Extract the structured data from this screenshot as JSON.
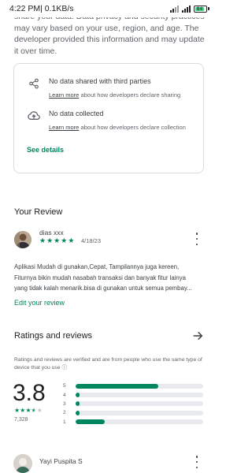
{
  "status_bar": {
    "time": "4:22 PM",
    "speed": " | 0.1KB/s",
    "battery_level": "84"
  },
  "data_safety": {
    "intro_text": "share your data. Data privacy and security practices may vary based on your use, region, and age. The developer provided this information and may update it over time.",
    "items": [
      {
        "icon": "share-icon",
        "title": "No data shared with third parties",
        "link_label": "Learn more",
        "link_suffix": " about how developers declare sharing"
      },
      {
        "icon": "cloud-upload-icon",
        "title": "No data collected",
        "link_label": "Learn more",
        "link_suffix": " about how developers declare collection"
      }
    ],
    "see_details_label": "See details"
  },
  "your_review": {
    "title": "Your Review",
    "reviewer_name": "dias xxx",
    "rating_stars": 5,
    "date": "4/18/23",
    "text_lines": [
      "Aplikasi Mudah di gunakan,Cepat, Tampilannya juga kereen,",
      "Fiturnya bikin mudah nasabah transaksi dan banyak fitur lainya",
      "yang tidak kalah menarik.bisa di gunakan untuk semua pembay..."
    ],
    "edit_label": "Edit your review"
  },
  "ratings": {
    "title": "Ratings and reviews",
    "note": "Ratings and reviews are verified and are from people who use the same type of device that you use ⓘ",
    "score": "3.8",
    "star_display": 3.5,
    "review_count": "7,328",
    "distribution": [
      {
        "label": "5",
        "fraction": 0.65
      },
      {
        "label": "4",
        "fraction": 0.03
      },
      {
        "label": "3",
        "fraction": 0.03
      },
      {
        "label": "2",
        "fraction": 0.03
      },
      {
        "label": "1",
        "fraction": 0.23
      }
    ],
    "accent_color": "#01875f",
    "track_color": "#e8eaed"
  },
  "next_review": {
    "reviewer_name": "Yayi Puspita S"
  }
}
